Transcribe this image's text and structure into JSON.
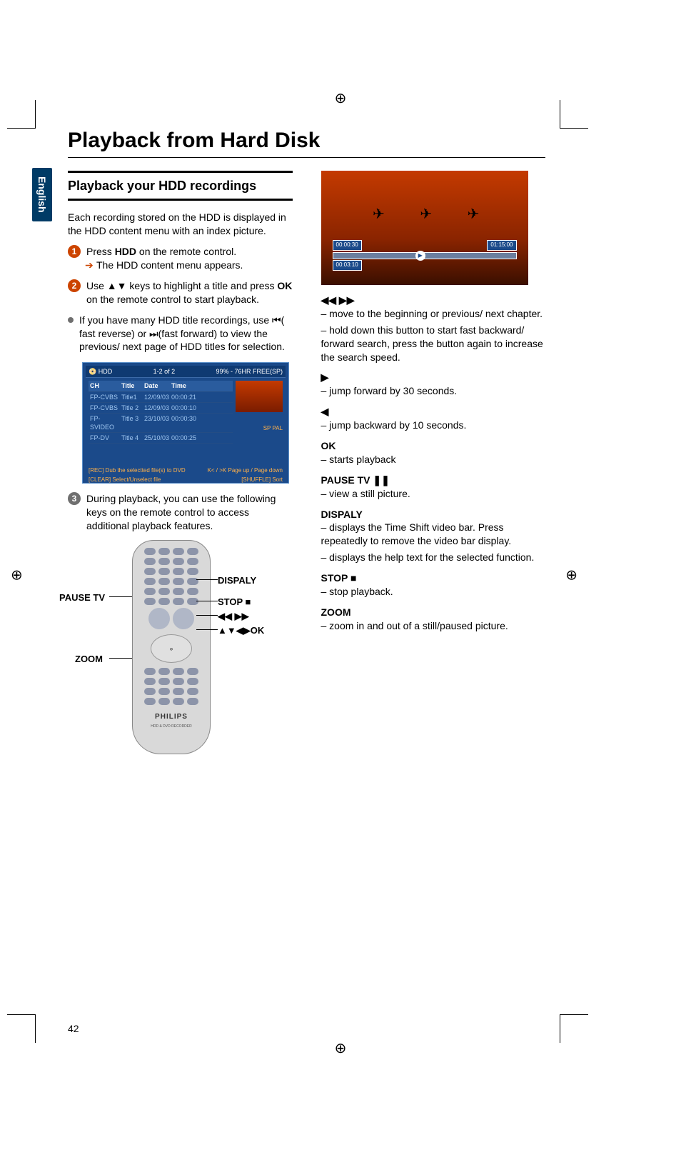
{
  "page_number": "42",
  "language_tab": "English",
  "title": "Playback from Hard Disk",
  "subhead": "Playback your HDD recordings",
  "intro": "Each recording stored on the HDD is displayed in the HDD content menu with an index picture.",
  "step1_a": "Press ",
  "step1_bold": "HDD",
  "step1_b": " on the remote control.",
  "step1_result": "The HDD content menu appears.",
  "step2_a": "Use ",
  "step2_glyph": "▲▼",
  "step2_b": " keys to highlight a title and press ",
  "step2_bold": "OK",
  "step2_c": " on the remote control to start playback.",
  "step2_note_a": "If you have many HDD title recordings, use ",
  "step2_note_rev_glyph": "⏮",
  "step2_note_rev": "( fast reverse) or ",
  "step2_note_fwd_glyph": "⏭",
  "step2_note_fwd": "(fast forward) to view the previous/ next page of HDD titles for selection.",
  "step3": "During playback, you can use the following keys on the remote control to access additional playback features.",
  "hdd_menu": {
    "tab": "HDD",
    "page": "1-2 of 2",
    "free": "99% - 76HR FREE(SP)",
    "headers": {
      "ch": "CH",
      "title": "Title",
      "date": "Date",
      "time": "Time"
    },
    "rows": [
      {
        "ch": "FP-CVBS",
        "title": "Title1",
        "date": "12/09/03",
        "time": "00:00:21"
      },
      {
        "ch": "FP-CVBS",
        "title": "Title 2",
        "date": "12/09/03",
        "time": "00:00:10"
      },
      {
        "ch": "FP-SVIDEO",
        "title": "Title 3",
        "date": "23/10/03",
        "time": "00:00:30"
      },
      {
        "ch": "FP-DV",
        "title": "Title 4",
        "date": "25/10/03",
        "time": "00:00:25"
      }
    ],
    "thumb_label": "SP PAL",
    "foot_rec": "[REC]  Dub the selectted file(s) to DVD",
    "foot_page": "K< / >K Page up / Page down",
    "foot_clear": "[CLEAR]  Select/Unselect file",
    "foot_shuffle": "[SHUFFLE]  Sort"
  },
  "remote_labels": {
    "pause_tv": "PAUSE TV",
    "zoom": "ZOOM",
    "display": "DISPALY",
    "stop": "STOP ■",
    "seek": "◀◀   ▶▶",
    "nav": "▲▼◀▶OK",
    "brand": "PHILIPS",
    "brand_sub": "HDD & DVD RECORDER"
  },
  "play_shot": {
    "time_l": "00:00:30",
    "time_r": "01:15:00",
    "time_b": "00:03:10"
  },
  "functions": {
    "seek_head": "◀◀   ▶▶",
    "seek_body1": "– move to the beginning or previous/ next chapter.",
    "seek_body2": "– hold down this button to start fast backward/ forward search, press the button again to increase the search speed.",
    "fwd_head": "▶",
    "fwd_body": "– jump forward by 30 seconds.",
    "back_head": "◀",
    "back_body": "– jump backward by 10 seconds.",
    "ok_head": "OK",
    "ok_body": "– starts playback",
    "pause_head": "PAUSE TV ❚❚",
    "pause_body": "– view a still picture.",
    "disp_head": "DISPALY",
    "disp_body1": "–  displays the Time Shift video bar. Press repeatedly to remove the video bar display.",
    "disp_body2": "–  displays the help text for the selected function.",
    "stop_head": "STOP ■",
    "stop_body": "– stop playback.",
    "zoom_head": "ZOOM",
    "zoom_body": "– zoom in and out of a still/paused picture."
  }
}
